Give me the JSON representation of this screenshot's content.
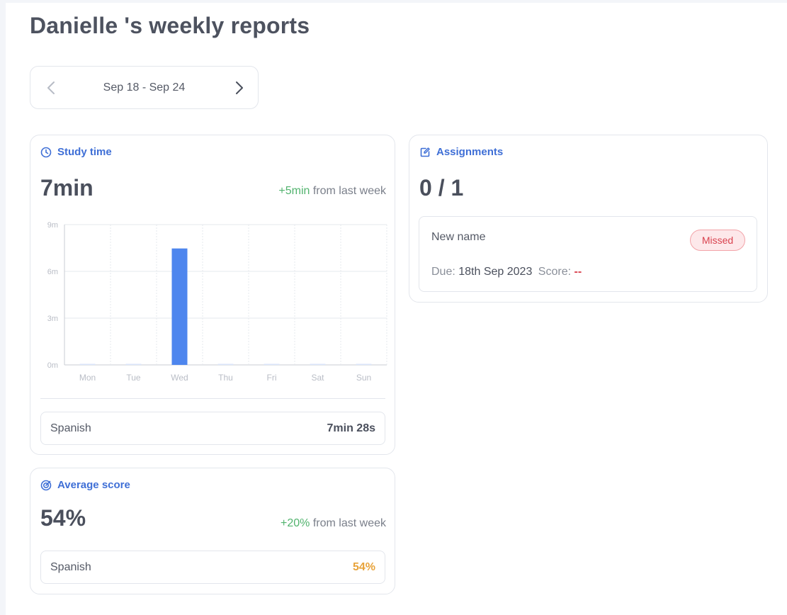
{
  "header": {
    "title": "Danielle 's weekly reports"
  },
  "week_nav": {
    "range": "Sep 18 - Sep 24",
    "prev_icon": "chevron-left-icon",
    "next_icon": "chevron-right-icon"
  },
  "study_time": {
    "heading": "Study time",
    "icon": "clock-icon",
    "total": "7min",
    "delta": "+5min",
    "delta_suffix": "from last week",
    "breakdown": {
      "subject": "Spanish",
      "value": "7min 28s"
    }
  },
  "average_score": {
    "heading": "Average score",
    "icon": "target-icon",
    "total": "54%",
    "delta": "+20%",
    "delta_suffix": "from last week",
    "breakdown": {
      "subject": "Spanish",
      "value": "54%"
    },
    "value_color": "#e8a33a"
  },
  "assignments": {
    "heading": "Assignments",
    "icon": "edit-icon",
    "count": "0 / 1",
    "items": [
      {
        "name": "New name",
        "status": "Missed",
        "due_label": "Due:",
        "due_date": "18th Sep 2023",
        "score_label": "Score:",
        "score": "--"
      }
    ]
  },
  "colors": {
    "accent": "#3f6fd6",
    "bar": "#4e86ee",
    "positive": "#52b36e",
    "missed": "#d9434f"
  },
  "chart_data": {
    "type": "bar",
    "categories": [
      "Mon",
      "Tue",
      "Wed",
      "Thu",
      "Fri",
      "Sat",
      "Sun"
    ],
    "values": [
      0,
      0,
      7.47,
      0,
      0,
      0,
      0
    ],
    "y_unit": "minutes",
    "y_ticks": [
      "0m",
      "3m",
      "6m",
      "9m"
    ],
    "ylim": [
      0,
      9
    ],
    "grid": true
  }
}
